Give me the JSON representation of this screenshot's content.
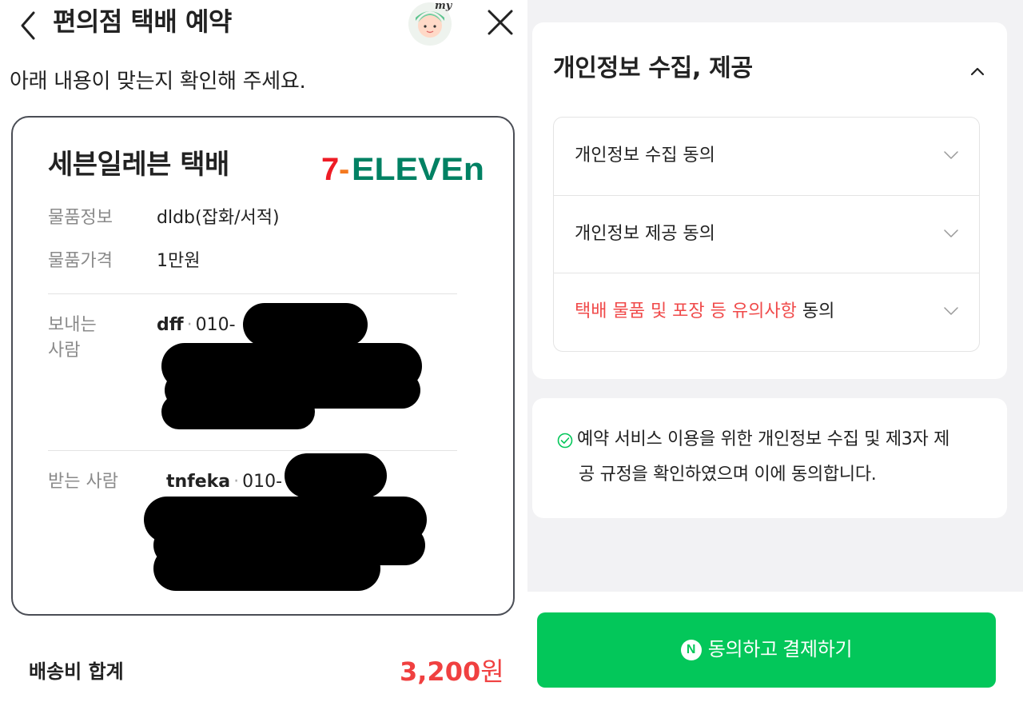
{
  "header": {
    "title": "편의점 택배 예약",
    "avatar_text": "my"
  },
  "instruction": "아래 내용이 맞는지 확인해 주세요.",
  "card": {
    "title": "세븐일레븐 택배",
    "brand": "7-ELEVEn",
    "item_info_label": "물품정보",
    "item_info_value": "dldb(잡화/서적)",
    "item_price_label": "물품가격",
    "item_price_value": "1만원",
    "sender_label_1": "보내는",
    "sender_label_2": "사람",
    "sender_name": "dff",
    "sender_phone": "010-",
    "receiver_label": "받는 사람",
    "receiver_name": "tnfeka",
    "receiver_phone": "010-"
  },
  "fee": {
    "label": "배송비 합계",
    "amount": "3,200",
    "unit": "원"
  },
  "consent": {
    "title": "개인정보 수집, 제공",
    "items": [
      {
        "label": "개인정보 수집 동의"
      },
      {
        "label": "개인정보 제공 동의"
      },
      {
        "label_red": "택배 물품 및 포장 등 유의사항",
        "label_suffix": " 동의"
      }
    ],
    "agreement_line1": "예약 서비스 이용을 위한 개인정보 수집 및 제3자 제",
    "agreement_line2": "공 규정을 확인하였으며 이에 동의합니다."
  },
  "pay_button": {
    "badge": "N",
    "label": "동의하고 결제하기"
  },
  "colors": {
    "accent_green": "#03c75a",
    "price_red": "#f04040",
    "warning_red": "#f04a4a",
    "brand_green": "#008163",
    "brand_orange": "#f47920",
    "brand_red": "#ee1c25"
  },
  "icons": [
    "chevron-left-icon",
    "close-icon",
    "avatar-icon",
    "chevron-up-icon",
    "chevron-down-icon",
    "check-circle-icon",
    "naver-n-icon"
  ]
}
